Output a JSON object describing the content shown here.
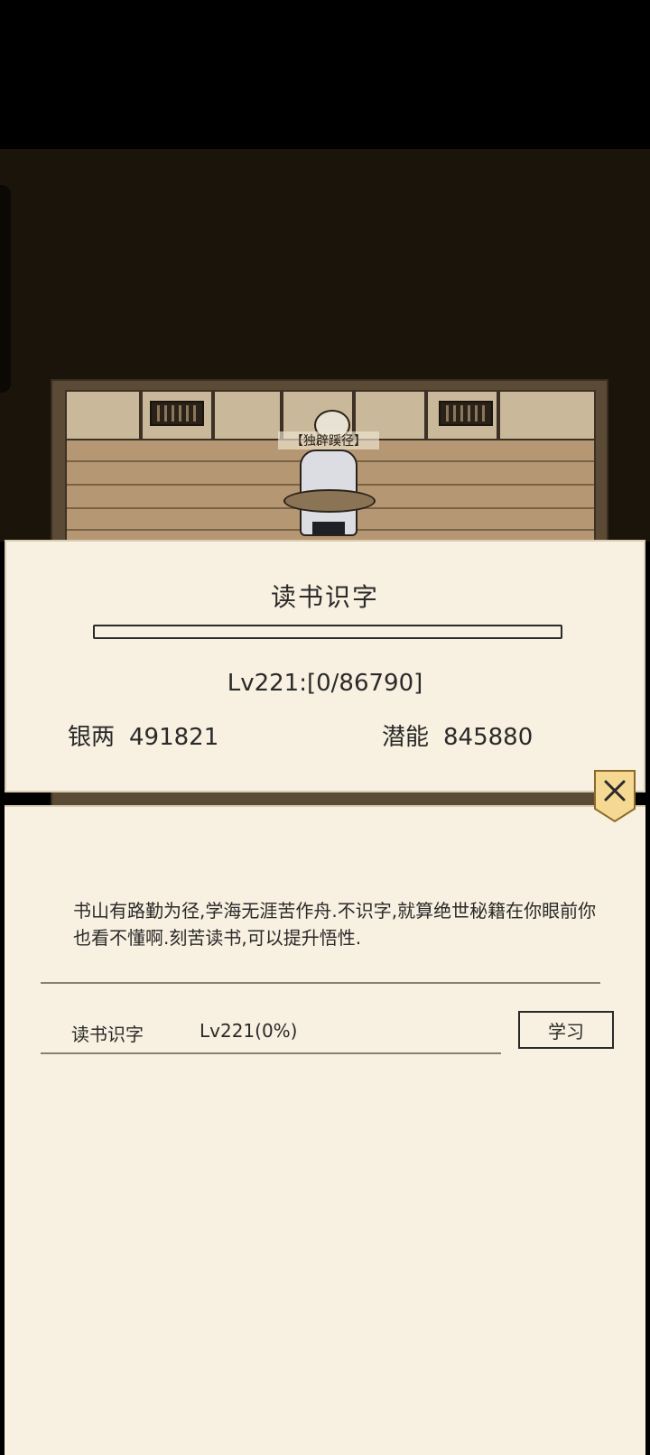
{
  "character": {
    "title": "【独辟蹊径】"
  },
  "dialog": {
    "title": "读书识字",
    "progress_fraction": 0,
    "level_text": "Lv221:[0/86790]",
    "silver": {
      "label": "银两",
      "value": "491821"
    },
    "potential": {
      "label": "潜能",
      "value": "845880"
    }
  },
  "close_icon": "close-icon",
  "description": "书山有路勤为径,学海无涯苦作舟.不识字,就算绝世秘籍在你眼前你也看不懂啊.刻苦读书,可以提升悟性.",
  "skill_row": {
    "name": "读书识字",
    "level": "Lv221(0%)",
    "button_label": "学习"
  },
  "colors": {
    "panel": "#f8f0e0",
    "text": "#2a2a2a",
    "badge": "#f5d892"
  }
}
